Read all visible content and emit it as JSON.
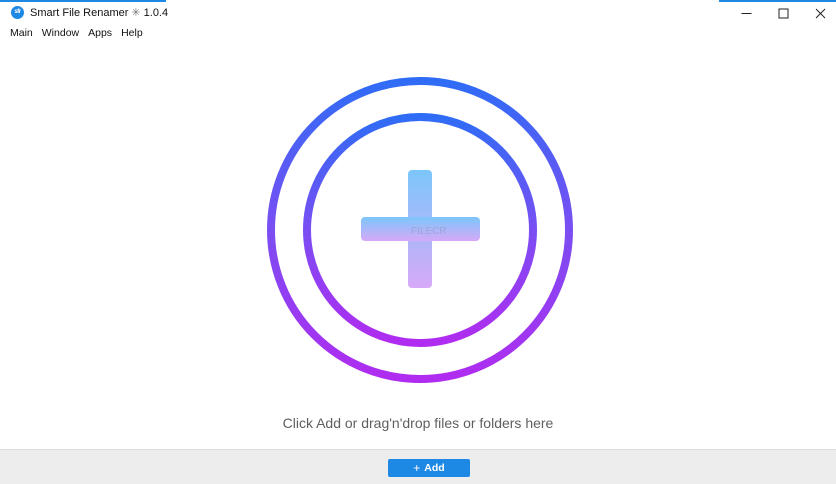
{
  "window": {
    "title": "Smart File Renamer",
    "separator": "✳",
    "version": "1.0.4",
    "icon_text": "sfr",
    "controls": {
      "minimize": "minimize-icon",
      "maximize": "maximize-icon",
      "close": "close-icon"
    }
  },
  "menu": {
    "items": [
      "Main",
      "Window",
      "Apps",
      "Help"
    ]
  },
  "dropzone": {
    "icon": "add-circle-icon",
    "watermark": "FILECR",
    "hint": "Click Add or drag'n'drop files or folders here"
  },
  "footer": {
    "add_icon": "plus-icon",
    "add_label": "Add"
  },
  "colors": {
    "accent": "#1e88e5",
    "ring_top": "#2f6cf6",
    "ring_bottom": "#b02cf0",
    "plus_top": "#7cc6fb",
    "plus_bottom": "#d6a9f8",
    "footer_bg": "#ededed"
  }
}
